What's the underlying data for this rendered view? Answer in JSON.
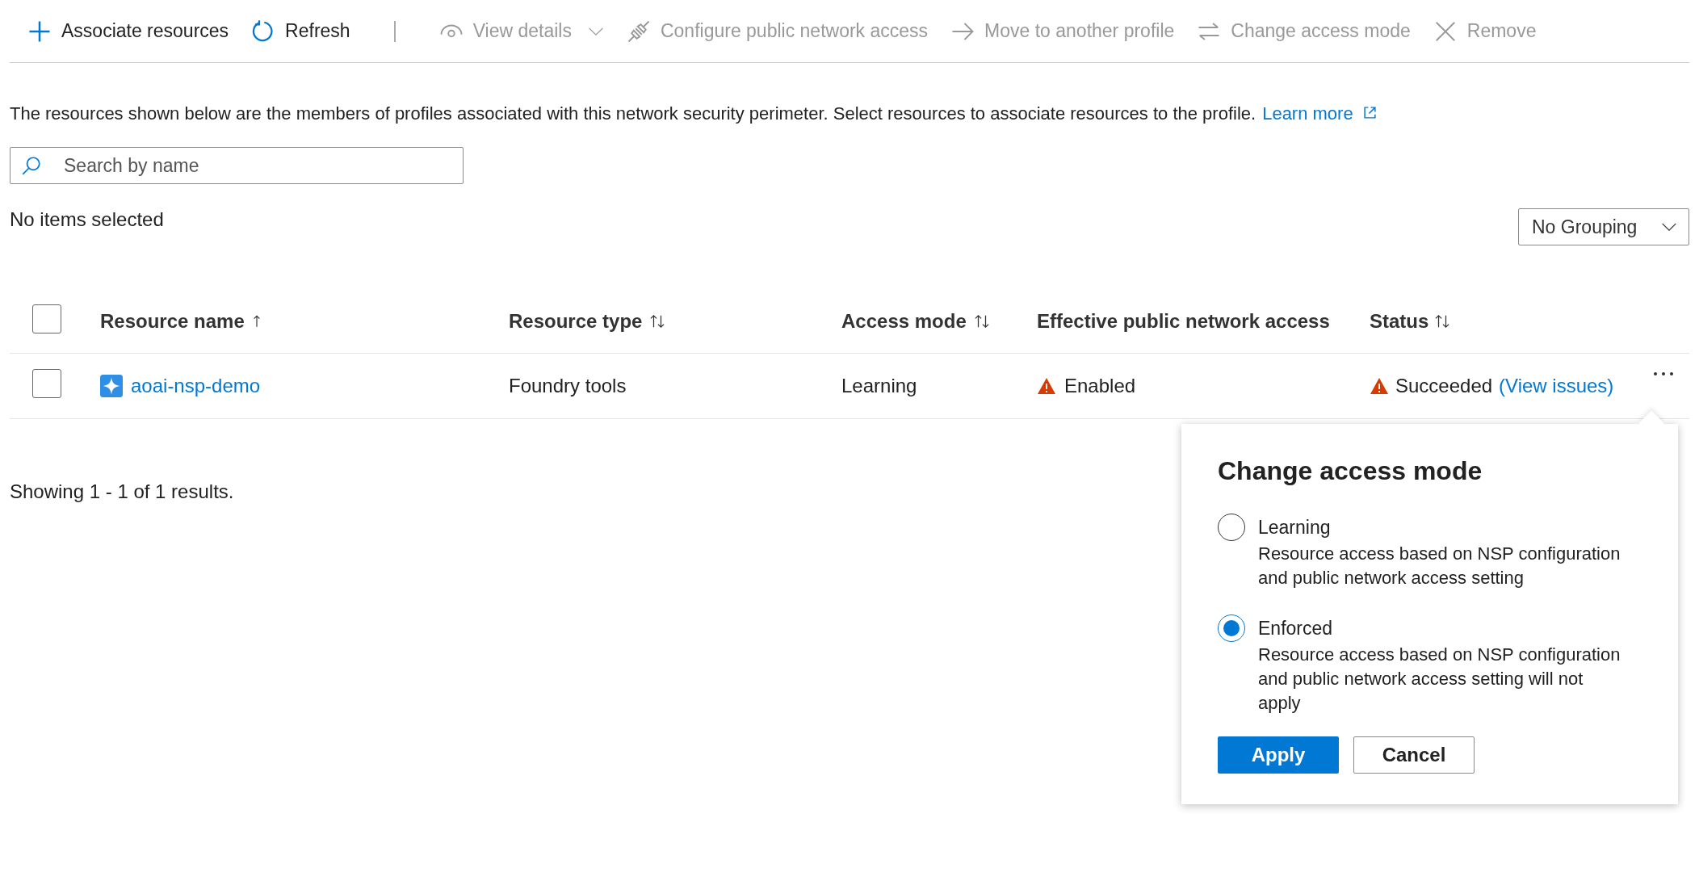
{
  "toolbar": [
    {
      "label": "Associate resources",
      "kind": "plus",
      "disabled": false,
      "dropdown": false
    },
    {
      "label": "Refresh",
      "kind": "refresh",
      "disabled": false,
      "dropdown": false
    },
    {
      "label": "View details",
      "kind": "eye",
      "disabled": true,
      "dropdown": true
    },
    {
      "label": "Configure public network access",
      "kind": "plug",
      "disabled": true,
      "dropdown": false
    },
    {
      "label": "Move to another profile",
      "kind": "arrow",
      "disabled": true,
      "dropdown": false
    },
    {
      "label": "Change access mode",
      "kind": "swap",
      "disabled": true,
      "dropdown": false
    },
    {
      "label": "Remove",
      "kind": "x",
      "disabled": true,
      "dropdown": false
    }
  ],
  "description": {
    "text": "The resources shown below are the members of profiles associated with this network security perimeter. Select resources to associate resources to the profile.",
    "link": "Learn more"
  },
  "search": {
    "placeholder": "Search by name"
  },
  "selection_status": "No items selected",
  "grouping": {
    "value": "No Grouping"
  },
  "table": {
    "select_all": {
      "checked": false
    },
    "columns": [
      {
        "label": "Resource name",
        "kind": "sorted"
      },
      {
        "label": "Resource type",
        "kind": "sortable"
      },
      {
        "label": "Access mode",
        "kind": "sortable"
      },
      {
        "label": "Effective public network access",
        "kind": "plain"
      },
      {
        "label": "Status",
        "kind": "sortable"
      }
    ],
    "rows": [
      {
        "checked": false,
        "name": "aoai-nsp-demo",
        "type": "Foundry tools",
        "access_mode": "Learning",
        "effective_access": "Enabled",
        "effective_warning": true,
        "status": "Succeeded",
        "status_warning": true,
        "status_link": "(View issues)"
      }
    ]
  },
  "results": "Showing 1 - 1 of 1 results.",
  "popup": {
    "title": "Change access mode",
    "options": [
      {
        "label": "Learning",
        "description": "Resource access based on NSP configuration and public network access setting",
        "selected": false
      },
      {
        "label": "Enforced",
        "description": "Resource access based on NSP configuration and public network access setting will not apply",
        "selected": true
      }
    ],
    "buttons": [
      {
        "label": "Apply",
        "kind": "primary"
      },
      {
        "label": "Cancel",
        "kind": "secondary"
      }
    ]
  }
}
